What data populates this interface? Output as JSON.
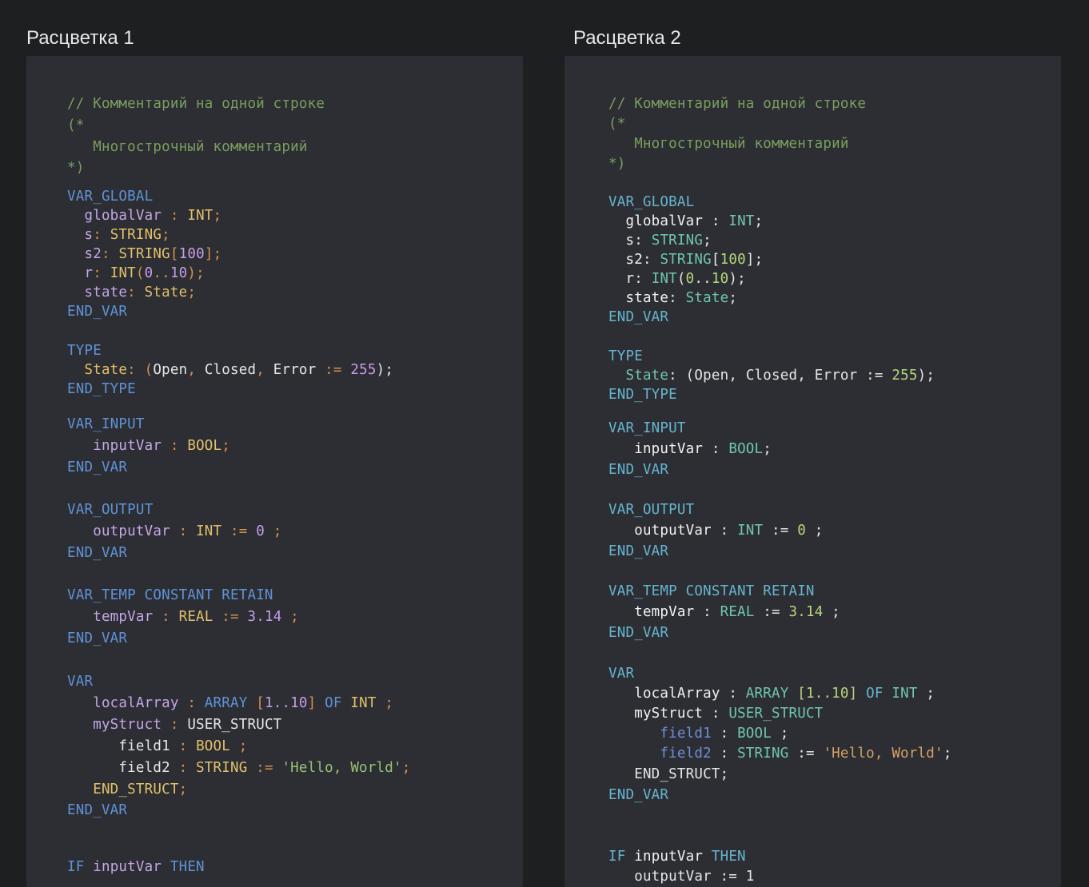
{
  "titles": [
    "Расцветка 1",
    "Расцветка 2"
  ],
  "code1": [
    [
      {
        "t": "// Комментарий на одной строке",
        "c": "comment"
      }
    ],
    [
      {
        "t": "(*",
        "c": "comment"
      }
    ],
    [
      {
        "t": "   Многострочный комментарий",
        "c": "comment"
      }
    ],
    [
      {
        "t": "*)",
        "c": "comment"
      }
    ],
    [
      {
        "t": "VAR_GLOBAL",
        "c": "kw"
      }
    ],
    [
      {
        "t": "  globalVar",
        "c": "var"
      },
      {
        "t": " : ",
        "c": "punct"
      },
      {
        "t": "INT",
        "c": "type"
      },
      {
        "t": ";",
        "c": "punct"
      }
    ],
    [
      {
        "t": "  s",
        "c": "var"
      },
      {
        "t": ": ",
        "c": "punct"
      },
      {
        "t": "STRING",
        "c": "type"
      },
      {
        "t": ";",
        "c": "punct"
      }
    ],
    [
      {
        "t": "  s2",
        "c": "var"
      },
      {
        "t": ": ",
        "c": "punct"
      },
      {
        "t": "STRING",
        "c": "type"
      },
      {
        "t": "[",
        "c": "punct"
      },
      {
        "t": "100",
        "c": "num"
      },
      {
        "t": "];",
        "c": "punct"
      }
    ],
    [
      {
        "t": "  r",
        "c": "var"
      },
      {
        "t": ": ",
        "c": "punct"
      },
      {
        "t": "INT",
        "c": "type"
      },
      {
        "t": "(",
        "c": "punct"
      },
      {
        "t": "0",
        "c": "num"
      },
      {
        "t": "..",
        "c": "punct"
      },
      {
        "t": "10",
        "c": "num"
      },
      {
        "t": ");",
        "c": "punct"
      }
    ],
    [
      {
        "t": "  state",
        "c": "var"
      },
      {
        "t": ": ",
        "c": "punct"
      },
      {
        "t": "State",
        "c": "type"
      },
      {
        "t": ";",
        "c": "punct"
      }
    ],
    [
      {
        "t": "END_VAR",
        "c": "kw"
      }
    ],
    [
      {
        "t": "TYPE",
        "c": "kw"
      }
    ],
    [
      {
        "t": "  State",
        "c": "type"
      },
      {
        "t": ": (",
        "c": "punct"
      },
      {
        "t": "Open",
        "c": "plain"
      },
      {
        "t": ", ",
        "c": "punct"
      },
      {
        "t": "Closed",
        "c": "plain"
      },
      {
        "t": ", ",
        "c": "punct"
      },
      {
        "t": "Error",
        "c": "plain"
      },
      {
        "t": " := ",
        "c": "punct"
      },
      {
        "t": "255",
        "c": "num"
      },
      {
        "t": ");",
        "c": "plain"
      }
    ],
    [
      {
        "t": "END_TYPE",
        "c": "kw"
      }
    ],
    [
      {
        "t": "VAR_INPUT",
        "c": "kw"
      }
    ],
    [
      {
        "t": "   inputVar",
        "c": "var"
      },
      {
        "t": " : ",
        "c": "punct"
      },
      {
        "t": "BOOL",
        "c": "type"
      },
      {
        "t": ";",
        "c": "punct"
      }
    ],
    [
      {
        "t": "END_VAR",
        "c": "kw"
      }
    ],
    [
      {
        "t": "VAR_OUTPUT",
        "c": "kw"
      }
    ],
    [
      {
        "t": "   outputVar",
        "c": "var"
      },
      {
        "t": " : ",
        "c": "punct"
      },
      {
        "t": "INT",
        "c": "type"
      },
      {
        "t": " := ",
        "c": "punct"
      },
      {
        "t": "0",
        "c": "num"
      },
      {
        "t": " ;",
        "c": "punct"
      }
    ],
    [
      {
        "t": "END_VAR",
        "c": "kw"
      }
    ],
    [
      {
        "t": "VAR_TEMP CONSTANT RETAIN",
        "c": "kw"
      }
    ],
    [
      {
        "t": "   tempVar",
        "c": "var"
      },
      {
        "t": " : ",
        "c": "punct"
      },
      {
        "t": "REAL",
        "c": "type"
      },
      {
        "t": " := ",
        "c": "punct"
      },
      {
        "t": "3.14",
        "c": "num"
      },
      {
        "t": " ;",
        "c": "punct"
      }
    ],
    [
      {
        "t": "END_VAR",
        "c": "kw"
      }
    ],
    [
      {
        "t": "VAR",
        "c": "kw"
      }
    ],
    [
      {
        "t": "   localArray",
        "c": "var"
      },
      {
        "t": " : ",
        "c": "punct"
      },
      {
        "t": "ARRAY ",
        "c": "kw"
      },
      {
        "t": "[",
        "c": "punct"
      },
      {
        "t": "1..10",
        "c": "num"
      },
      {
        "t": "] ",
        "c": "punct"
      },
      {
        "t": "OF ",
        "c": "kw"
      },
      {
        "t": "INT",
        "c": "type"
      },
      {
        "t": " ;",
        "c": "punct"
      }
    ],
    [
      {
        "t": "   myStruct",
        "c": "var"
      },
      {
        "t": " : ",
        "c": "punct"
      },
      {
        "t": "USER_STRUCT",
        "c": "plain"
      }
    ],
    [
      {
        "t": "      field1",
        "c": "plain"
      },
      {
        "t": " : ",
        "c": "punct"
      },
      {
        "t": "BOOL",
        "c": "type"
      },
      {
        "t": " ;",
        "c": "punct"
      }
    ],
    [
      {
        "t": "      field2",
        "c": "plain"
      },
      {
        "t": " : ",
        "c": "punct"
      },
      {
        "t": "STRING",
        "c": "type"
      },
      {
        "t": " := ",
        "c": "punct"
      },
      {
        "t": "'Hello, World'",
        "c": "str"
      },
      {
        "t": ";",
        "c": "punct"
      }
    ],
    [
      {
        "t": "   END_STRUCT",
        "c": "type"
      },
      {
        "t": ";",
        "c": "punct"
      }
    ],
    [
      {
        "t": "END_VAR",
        "c": "kw"
      }
    ],
    [
      {
        "t": "IF ",
        "c": "kw"
      },
      {
        "t": "inputVar ",
        "c": "var"
      },
      {
        "t": "THEN",
        "c": "kw"
      }
    ]
  ],
  "code2": [
    [
      {
        "t": "// Комментарий на одной строке",
        "c": "comment"
      }
    ],
    [
      {
        "t": "(*",
        "c": "comment"
      }
    ],
    [
      {
        "t": "   Многострочный комментарий",
        "c": "comment"
      }
    ],
    [
      {
        "t": "*)",
        "c": "comment"
      }
    ],
    [
      {
        "t": "VAR_GLOBAL",
        "c": "kw"
      }
    ],
    [
      {
        "t": "  globalVar",
        "c": "var"
      },
      {
        "t": " : ",
        "c": "punct"
      },
      {
        "t": "INT",
        "c": "type"
      },
      {
        "t": ";",
        "c": "punct"
      }
    ],
    [
      {
        "t": "  s",
        "c": "var"
      },
      {
        "t": ": ",
        "c": "punct"
      },
      {
        "t": "STRING",
        "c": "type"
      },
      {
        "t": ";",
        "c": "punct"
      }
    ],
    [
      {
        "t": "  s2",
        "c": "var"
      },
      {
        "t": ": ",
        "c": "punct"
      },
      {
        "t": "STRING",
        "c": "type"
      },
      {
        "t": "[",
        "c": "punct"
      },
      {
        "t": "100",
        "c": "num"
      },
      {
        "t": "];",
        "c": "punct"
      }
    ],
    [
      {
        "t": "  r",
        "c": "var"
      },
      {
        "t": ": ",
        "c": "punct"
      },
      {
        "t": "INT",
        "c": "type"
      },
      {
        "t": "(",
        "c": "punct"
      },
      {
        "t": "0",
        "c": "num"
      },
      {
        "t": "..",
        "c": "punct"
      },
      {
        "t": "10",
        "c": "num"
      },
      {
        "t": ");",
        "c": "punct"
      }
    ],
    [
      {
        "t": "  state",
        "c": "var"
      },
      {
        "t": ": ",
        "c": "punct"
      },
      {
        "t": "State",
        "c": "type"
      },
      {
        "t": ";",
        "c": "punct"
      }
    ],
    [
      {
        "t": "END_VAR",
        "c": "kw"
      }
    ],
    [
      {
        "t": "TYPE",
        "c": "kw"
      }
    ],
    [
      {
        "t": "  State",
        "c": "type"
      },
      {
        "t": ": (",
        "c": "punct"
      },
      {
        "t": "Open",
        "c": "plain"
      },
      {
        "t": ", ",
        "c": "punct"
      },
      {
        "t": "Closed",
        "c": "plain"
      },
      {
        "t": ", ",
        "c": "punct"
      },
      {
        "t": "Error",
        "c": "plain"
      },
      {
        "t": " := ",
        "c": "punct"
      },
      {
        "t": "255",
        "c": "num"
      },
      {
        "t": ");",
        "c": "punct"
      }
    ],
    [
      {
        "t": "END_TYPE",
        "c": "kw"
      }
    ],
    [
      {
        "t": "VAR_INPUT",
        "c": "kw"
      }
    ],
    [
      {
        "t": "   inputVar",
        "c": "var"
      },
      {
        "t": " : ",
        "c": "punct"
      },
      {
        "t": "BOOL",
        "c": "type"
      },
      {
        "t": ";",
        "c": "punct"
      }
    ],
    [
      {
        "t": "END_VAR",
        "c": "kw"
      }
    ],
    [
      {
        "t": "VAR_OUTPUT",
        "c": "kw"
      }
    ],
    [
      {
        "t": "   outputVar",
        "c": "var"
      },
      {
        "t": " : ",
        "c": "punct"
      },
      {
        "t": "INT",
        "c": "type"
      },
      {
        "t": " := ",
        "c": "punct"
      },
      {
        "t": "0",
        "c": "num"
      },
      {
        "t": " ;",
        "c": "punct"
      }
    ],
    [
      {
        "t": "END_VAR",
        "c": "kw"
      }
    ],
    [
      {
        "t": "VAR_TEMP CONSTANT RETAIN",
        "c": "kw"
      }
    ],
    [
      {
        "t": "   tempVar",
        "c": "var"
      },
      {
        "t": " : ",
        "c": "punct"
      },
      {
        "t": "REAL",
        "c": "type"
      },
      {
        "t": " := ",
        "c": "punct"
      },
      {
        "t": "3.14",
        "c": "num"
      },
      {
        "t": " ;",
        "c": "punct"
      }
    ],
    [
      {
        "t": "END_VAR",
        "c": "kw"
      }
    ],
    [
      {
        "t": "VAR",
        "c": "kw"
      }
    ],
    [
      {
        "t": "   localArray",
        "c": "var"
      },
      {
        "t": " : ",
        "c": "punct"
      },
      {
        "t": "ARRAY ",
        "c": "type"
      },
      {
        "t": "[",
        "c": "num"
      },
      {
        "t": "1..10",
        "c": "num"
      },
      {
        "t": "] ",
        "c": "num"
      },
      {
        "t": "OF ",
        "c": "kw"
      },
      {
        "t": "INT",
        "c": "type"
      },
      {
        "t": " ;",
        "c": "punct"
      }
    ],
    [
      {
        "t": "   myStruct",
        "c": "var"
      },
      {
        "t": " : ",
        "c": "punct"
      },
      {
        "t": "USER_STRUCT",
        "c": "type"
      }
    ],
    [
      {
        "t": "      field1",
        "c": "field"
      },
      {
        "t": " : ",
        "c": "punct"
      },
      {
        "t": "BOOL",
        "c": "type"
      },
      {
        "t": " ;",
        "c": "punct"
      }
    ],
    [
      {
        "t": "      field2",
        "c": "field"
      },
      {
        "t": " : ",
        "c": "punct"
      },
      {
        "t": "STRING",
        "c": "type"
      },
      {
        "t": " := ",
        "c": "punct"
      },
      {
        "t": "'Hello, World'",
        "c": "str"
      },
      {
        "t": ";",
        "c": "punct"
      }
    ],
    [
      {
        "t": "   END_STRUCT",
        "c": "plain"
      },
      {
        "t": ";",
        "c": "punct"
      }
    ],
    [
      {
        "t": "END_VAR",
        "c": "kw"
      }
    ],
    [
      {
        "t": "IF ",
        "c": "kw"
      },
      {
        "t": "inputVar ",
        "c": "var"
      },
      {
        "t": "THEN",
        "c": "kw"
      }
    ],
    [
      {
        "t": "   outputVar := 1",
        "c": "plain"
      }
    ]
  ]
}
